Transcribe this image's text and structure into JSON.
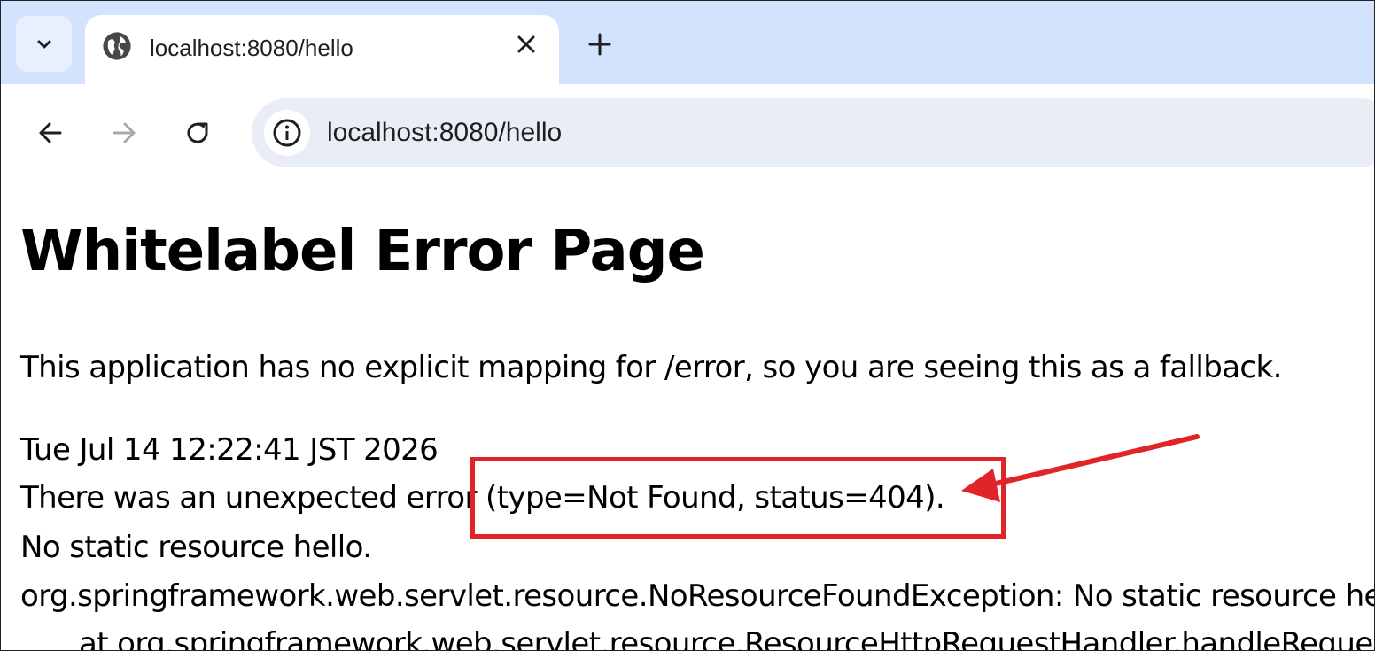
{
  "browser": {
    "tab": {
      "title": "localhost:8080/hello"
    },
    "address_bar": {
      "url": "localhost:8080/hello"
    },
    "icons": {
      "tab_dropdown": "chevron-down-icon",
      "favicon": "globe-icon",
      "close": "close-icon",
      "new_tab": "plus-icon",
      "back": "arrow-left-icon",
      "forward": "arrow-right-icon",
      "reload": "reload-icon",
      "site_info": "info-icon"
    }
  },
  "page": {
    "title": "Whitelabel Error Page",
    "fallback_message": "This application has no explicit mapping for /error, so you are seeing this as a fallback.",
    "timestamp": "Tue Jul 14 12:22:41 JST 2026",
    "error_message": "There was an unexpected error (type=Not Found, status=404).",
    "detail": "No static resource hello.",
    "exception": "org.springframework.web.servlet.resource.NoResourceFoundException: No static resource hello.",
    "stack_trace_first_line": "at org.springframework.web.servlet.resource.ResourceHttpRequestHandler.handleRequest"
  },
  "annotation": {
    "color": "#e02427"
  }
}
